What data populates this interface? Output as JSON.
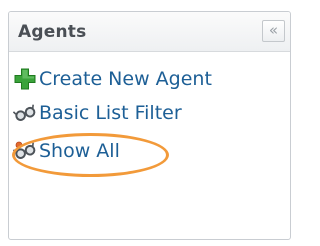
{
  "panel": {
    "title": "Agents",
    "collapse_icon_glyph": "«"
  },
  "menu": {
    "items": [
      {
        "label": "Create New Agent",
        "icon": "plus-icon",
        "icon_color": "#3aa33a"
      },
      {
        "label": "Basic List Filter",
        "icon": "glasses-icon",
        "icon_color": "#555b62"
      },
      {
        "label": "Show All",
        "icon": "glasses-icon",
        "icon_color": "#555b62",
        "highlighted": true
      }
    ]
  },
  "colors": {
    "link": "#1d5f96",
    "highlight_ring": "#f29a3a"
  }
}
